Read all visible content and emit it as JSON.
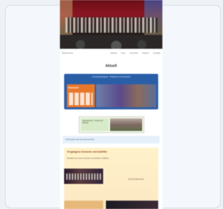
{
  "nav": {
    "brand": "Männerchor",
    "links": [
      "Aktuell",
      "Chor",
      "Konzerte",
      "Galerie",
      "Kontakt"
    ]
  },
  "page": {
    "title": "Aktuell",
    "banner_caption": "Konzertankündigung – Programm und Vorverkauf",
    "logo_text": "Konzert",
    "poster_text": "Jahreskonzert – Eintritt frei, Kollekte",
    "notice_text": "Probenarbeit nach den Sommerferien",
    "events_heading": "Vergangene Konzerte und Auftritte",
    "events_text": "Rückblick auf unsere Konzerte und Auftritte mit Bildern",
    "events_caption": "Konzert Männerchor"
  },
  "colors": {
    "banner": "#2a5fa8",
    "logo": "#e9772b",
    "events_bg": "#fff2c9",
    "notice_bg": "#e6f0fb"
  }
}
